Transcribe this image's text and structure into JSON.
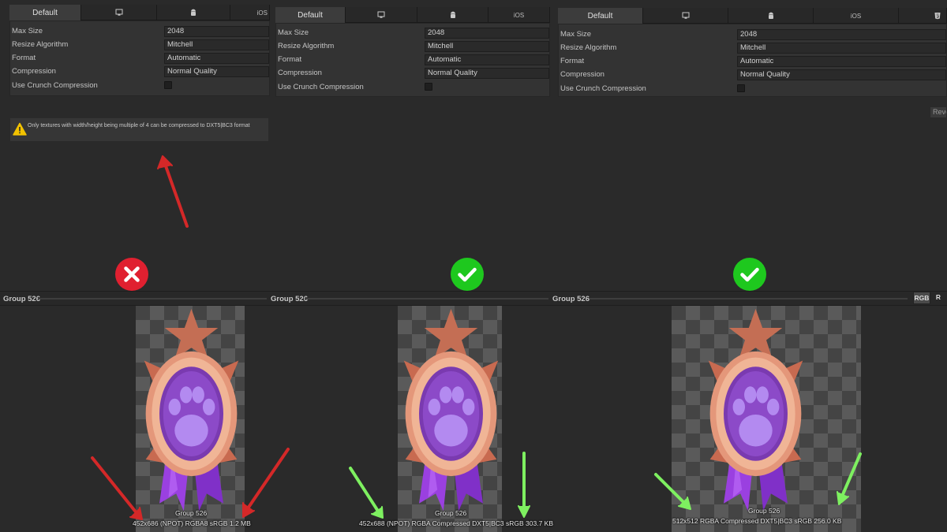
{
  "panels": [
    {
      "tabs": {
        "default": "Default",
        "desktop_icon": "monitor-icon",
        "android_icon": "android-icon",
        "ios": "iOS"
      },
      "settings": [
        {
          "label": "Max Size",
          "value": "2048"
        },
        {
          "label": "Resize Algorithm",
          "value": "Mitchell"
        },
        {
          "label": "Format",
          "value": "Automatic"
        },
        {
          "label": "Compression",
          "value": "Normal Quality"
        },
        {
          "label": "Use Crunch Compression",
          "value": ""
        }
      ],
      "warning": "Only textures with width/height being multiple of 4 can be compressed to DXT5|BC3 format",
      "status": "error",
      "group_label": "Group 526",
      "image_name": "Group 526",
      "info": {
        "dims": "452x686 (NPOT)",
        "format": "RGBA8 sRGB",
        "size": "1.2 MB"
      }
    },
    {
      "tabs": {
        "default": "Default",
        "desktop_icon": "monitor-icon",
        "android_icon": "android-icon",
        "ios": "iOS"
      },
      "settings": [
        {
          "label": "Max Size",
          "value": "2048"
        },
        {
          "label": "Resize Algorithm",
          "value": "Mitchell"
        },
        {
          "label": "Format",
          "value": "Automatic"
        },
        {
          "label": "Compression",
          "value": "Normal Quality"
        },
        {
          "label": "Use Crunch Compression",
          "value": ""
        }
      ],
      "status": "ok",
      "group_label": "Group 526",
      "image_name": "Group 526",
      "info": {
        "dims": "452x688 (NPOT)",
        "format": "RGBA Compressed DXT5|BC3 sRGB",
        "size": "303.7 KB"
      }
    },
    {
      "tabs": {
        "default": "Default",
        "desktop_icon": "monitor-icon",
        "android_icon": "android-icon",
        "ios": "iOS"
      },
      "settings": [
        {
          "label": "Max Size",
          "value": "2048"
        },
        {
          "label": "Resize Algorithm",
          "value": "Mitchell"
        },
        {
          "label": "Format",
          "value": "Automatic"
        },
        {
          "label": "Compression",
          "value": "Normal Quality"
        },
        {
          "label": "Use Crunch Compression",
          "value": ""
        }
      ],
      "revert": "Revert",
      "status": "ok",
      "group_label": "Group 526",
      "image_name": "Group 526",
      "info": {
        "dims": "512x512",
        "format": "RGBA Compressed DXT5|BC3 sRGB",
        "size": "256.0 KB"
      },
      "channel_buttons": {
        "rgb": "RGB",
        "r": "R"
      }
    }
  ],
  "colors": {
    "error": "#e02030",
    "ok": "#1ec81e",
    "arrow_red": "#d42828",
    "arrow_green": "#7ef060"
  }
}
